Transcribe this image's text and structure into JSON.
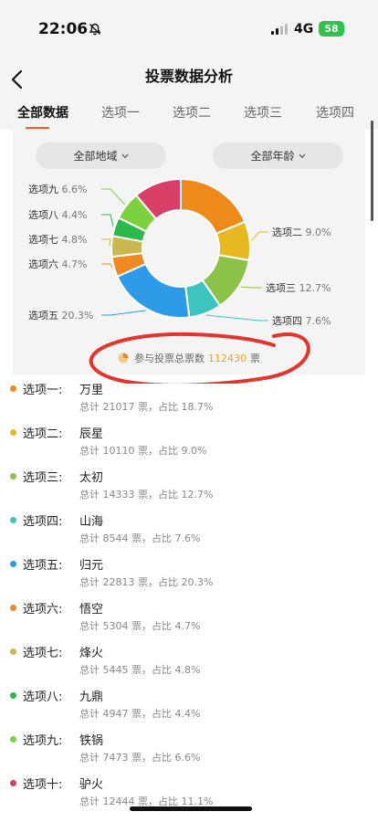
{
  "status": {
    "time": "22:06",
    "network": "4G",
    "battery": "58"
  },
  "header": {
    "title": "投票数据分析"
  },
  "tabs": [
    "全部数据",
    "选项一",
    "选项二",
    "选项三",
    "选项四"
  ],
  "filters": {
    "region": "全部地域",
    "age": "全部年龄"
  },
  "chart_data": {
    "type": "pie",
    "categories": [
      "选项一",
      "选项二",
      "选项三",
      "选项四",
      "选项五",
      "选项六",
      "选项七",
      "选项八",
      "选项九",
      "选项十"
    ],
    "values": [
      18.7,
      9.0,
      12.7,
      7.6,
      20.3,
      4.7,
      4.8,
      4.4,
      6.6,
      11.1
    ],
    "labels": [
      "",
      "9.0%",
      "12.7%",
      "7.6%",
      "20.3%",
      "4.7%",
      "4.8%",
      "4.4%",
      "6.6%",
      ""
    ],
    "colors": [
      "#ee8a1a",
      "#e8b820",
      "#8cc14a",
      "#3cc4c0",
      "#2d9be8",
      "#ef8a22",
      "#c9b84d",
      "#2cb84a",
      "#7cd23e",
      "#d84068"
    ],
    "legend": "none"
  },
  "total": {
    "prefix": "参与投票总票数",
    "value": "112430",
    "suffix": "票"
  },
  "items": [
    {
      "label": "选项一:",
      "name": "万里",
      "detail": "总计 21017 票，占比 18.7%",
      "color": "#ee8a1a"
    },
    {
      "label": "选项二:",
      "name": "辰星",
      "detail": "总计 10110 票，占比 9.0%",
      "color": "#e8b820"
    },
    {
      "label": "选项三:",
      "name": "太初",
      "detail": "总计 14333 票，占比 12.7%",
      "color": "#8cc14a"
    },
    {
      "label": "选项四:",
      "name": "山海",
      "detail": "总计 8544 票，占比 7.6%",
      "color": "#3cc4c0"
    },
    {
      "label": "选项五:",
      "name": "归元",
      "detail": "总计 22813 票，占比 20.3%",
      "color": "#2d9be8"
    },
    {
      "label": "选项六:",
      "name": "悟空",
      "detail": "总计 5304 票，占比 4.7%",
      "color": "#ef8a22"
    },
    {
      "label": "选项七:",
      "name": "烽火",
      "detail": "总计 5445 票，占比 4.8%",
      "color": "#c9b84d"
    },
    {
      "label": "选项八:",
      "name": "九鼎",
      "detail": "总计 4947 票，占比 4.4%",
      "color": "#2cb84a"
    },
    {
      "label": "选项九:",
      "name": "铁锅",
      "detail": "总计 7473 票，占比 6.6%",
      "color": "#7cd23e"
    },
    {
      "label": "选项十:",
      "name": "驴火",
      "detail": "总计 12444 票，占比 11.1%",
      "color": "#d84068"
    }
  ]
}
